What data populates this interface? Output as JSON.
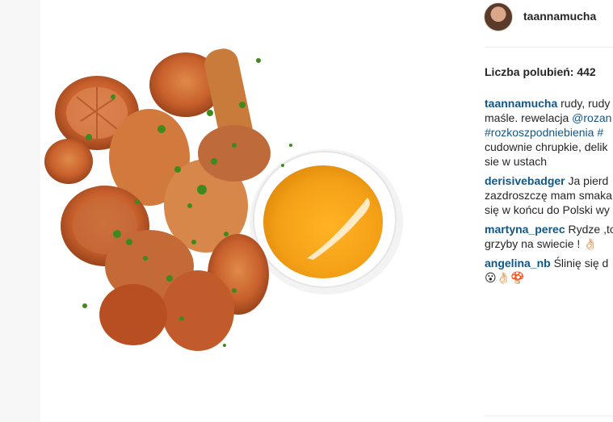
{
  "post": {
    "author": "taannamucha",
    "likes_label": "Liczba polubień: 442"
  },
  "comments": [
    {
      "user": "taannamucha",
      "first_line_text": " rudy, rudy",
      "lines": [
        {
          "a": "maśle. rewelacja ",
          "b": "@rozan"
        },
        {
          "a": "#rozkoszpodniebienia #",
          "b": ""
        },
        {
          "a": "cudownie chrupkie, delik",
          "b": ""
        },
        {
          "a": "sie w ustach",
          "b": ""
        }
      ]
    },
    {
      "user": "derisivebadger",
      "first_line_text": " Ja pierd",
      "lines": [
        {
          "a": "zazdroszczę mam smaka",
          "b": ""
        },
        {
          "a": "się w końcu do Polski wy",
          "b": ""
        }
      ]
    },
    {
      "user": "martyna_perec",
      "first_line_text": " Rydze ,to",
      "lines": [
        {
          "a": "grzyby na swiecie ! 👌🏻",
          "b": ""
        }
      ]
    },
    {
      "user": "angelina_nb",
      "first_line_text": " Ślinię się d",
      "lines": [
        {
          "a": "😮👌🏻🍄",
          "b": ""
        }
      ]
    }
  ]
}
